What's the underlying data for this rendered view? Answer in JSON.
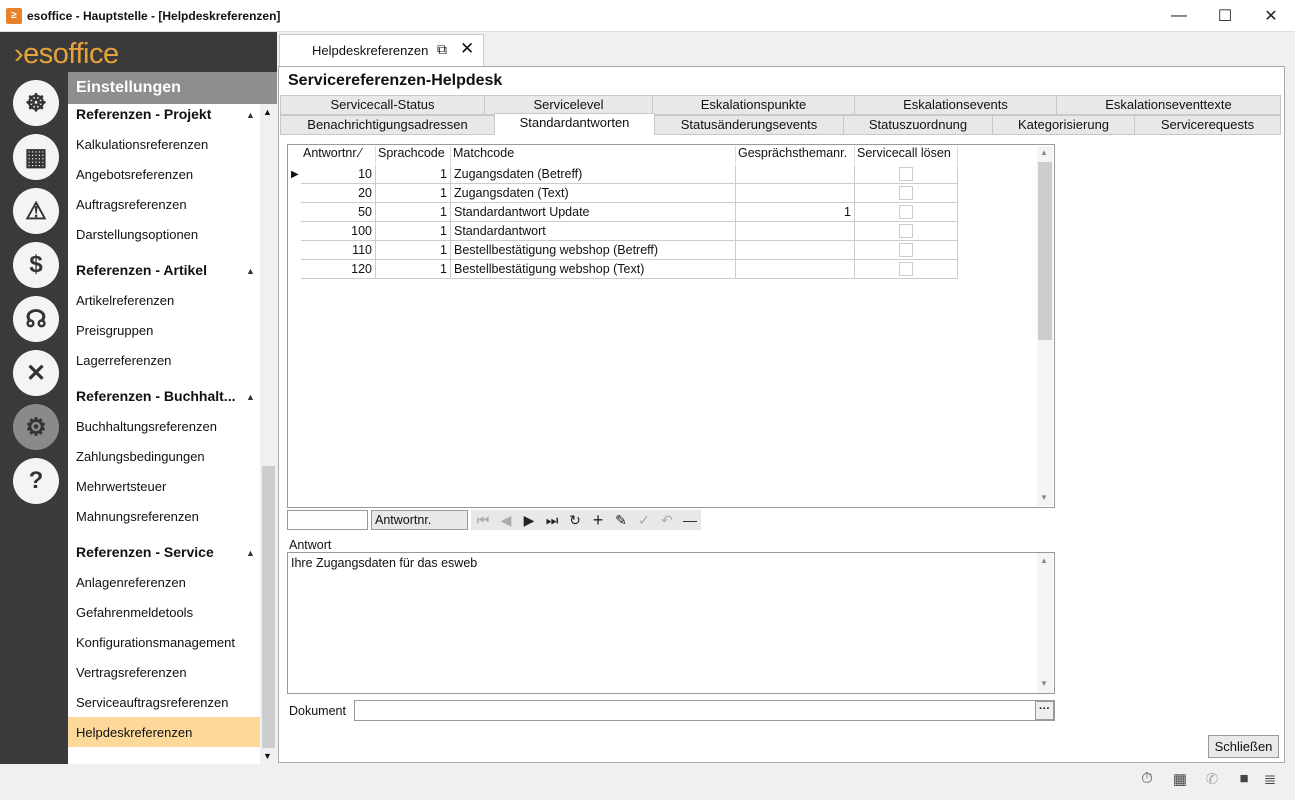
{
  "window": {
    "title": "esoffice - Hauptstelle - [Helpdeskreferenzen]",
    "minimize": "—",
    "maximize": "☐",
    "close": "✕",
    "app_icon": "≥"
  },
  "logo": "›esoffice",
  "rail": {
    "icons": [
      "helm-icon",
      "calendar-grid-icon",
      "alarm-light-icon",
      "money-icon",
      "headset-icon",
      "tools-icon",
      "gears-icon",
      "help-icon"
    ]
  },
  "sidebar": {
    "header": "Einstellungen",
    "sections": [
      {
        "title": "Referenzen - Projekt",
        "items": [
          "Kalkulationsreferenzen",
          "Angebotsreferenzen",
          "Auftragsreferenzen",
          "Darstellungsoptionen"
        ]
      },
      {
        "title": "Referenzen - Artikel",
        "items": [
          "Artikelreferenzen",
          "Preisgruppen",
          "Lagerreferenzen"
        ]
      },
      {
        "title": "Referenzen - Buchhalt...",
        "items": [
          "Buchhaltungsreferenzen",
          "Zahlungsbedingungen",
          "Mehrwertsteuer",
          "Mahnungsreferenzen"
        ]
      },
      {
        "title": "Referenzen - Service",
        "items": [
          "Anlagenreferenzen",
          "Gefahrenmeldetools",
          "Konfigurationsmanagement",
          "Vertragsreferenzen",
          "Serviceauftragsreferenzen",
          "Helpdeskreferenzen"
        ]
      }
    ],
    "selected": "Helpdeskreferenzen"
  },
  "doc_tab": {
    "label": "Helpdeskreferenzen"
  },
  "page": {
    "title": "Servicereferenzen-Helpdesk",
    "tabs_row1": [
      "Servicecall-Status",
      "Servicelevel",
      "Eskalationspunkte",
      "Eskalationsevents",
      "Eskalationseventtexte"
    ],
    "tabs_row2": [
      "Benachrichtigungsadressen",
      "Standardantworten",
      "Statusänderungsevents",
      "Statuszuordnung",
      "Kategorisierung",
      "Servicerequests"
    ],
    "selected_tab": "Standardantworten"
  },
  "grid": {
    "columns": [
      "Antwortnr.",
      "Sprachcode",
      "Matchcode",
      "Gesprächsthemanr.",
      "Servicecall lösen"
    ],
    "sort_indicator": "⁄",
    "rows": [
      {
        "nr": "10",
        "lang": "1",
        "match": "Zugangsdaten (Betreff)",
        "topic": "",
        "solve": false
      },
      {
        "nr": "20",
        "lang": "1",
        "match": "Zugangsdaten (Text)",
        "topic": "",
        "solve": false
      },
      {
        "nr": "50",
        "lang": "1",
        "match": "Standardantwort Update",
        "topic": "1",
        "solve": false
      },
      {
        "nr": "100",
        "lang": "1",
        "match": "Standardantwort",
        "topic": "",
        "solve": false
      },
      {
        "nr": "110",
        "lang": "1",
        "match": "Bestellbestätigung webshop (Betreff)",
        "topic": "",
        "solve": false
      },
      {
        "nr": "120",
        "lang": "1",
        "match": "Bestellbestätigung webshop (Text)",
        "topic": "",
        "solve": false
      }
    ]
  },
  "navigator": {
    "search_value": "",
    "search_field": "Antwortnr."
  },
  "answer": {
    "label": "Antwort",
    "value": "Ihre Zugangsdaten für das esweb"
  },
  "document": {
    "label": "Dokument",
    "value": "",
    "browse": "···"
  },
  "close_button": "Schließen"
}
